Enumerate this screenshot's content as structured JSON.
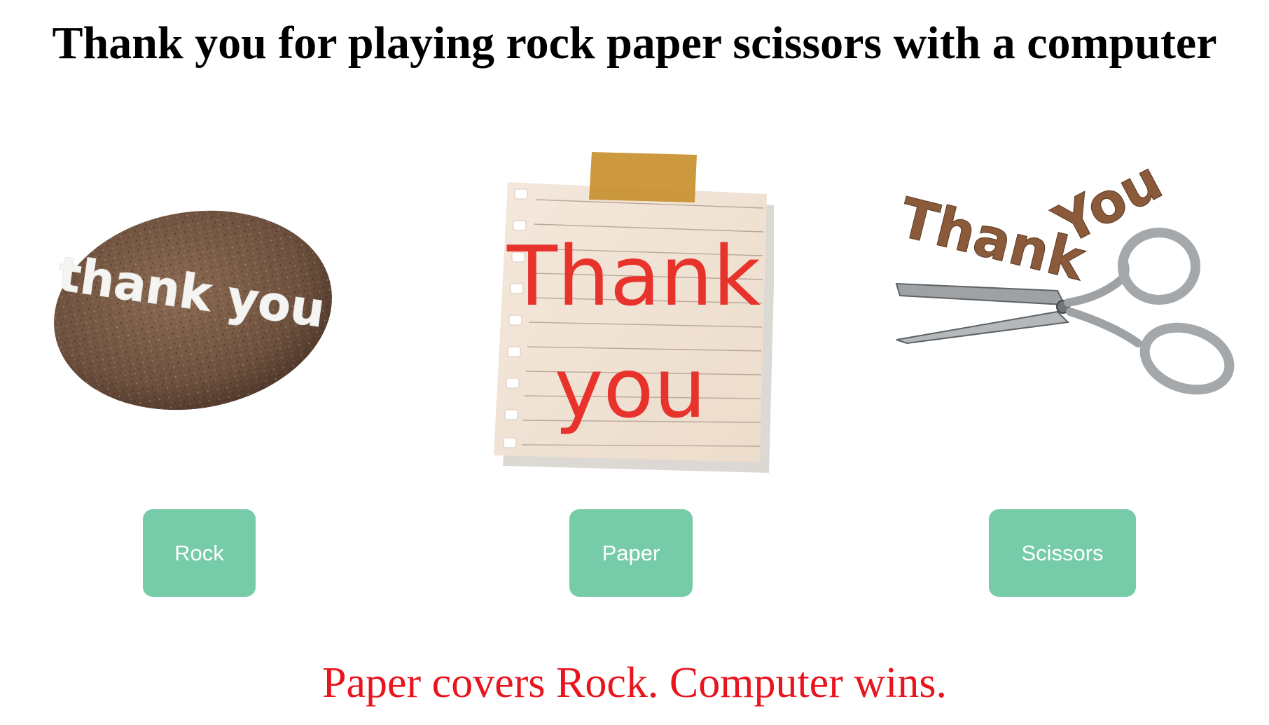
{
  "header": {
    "title": "Thank you for playing rock paper scissors with a computer"
  },
  "choices": [
    {
      "id": "rock",
      "button_label": "Rock",
      "image_text": "thank you",
      "icon": "rock-icon"
    },
    {
      "id": "paper",
      "button_label": "Paper",
      "image_text_line1": "Thank",
      "image_text_line2": "you",
      "icon": "paper-note-icon"
    },
    {
      "id": "scissors",
      "button_label": "Scissors",
      "image_text_word1": "Thank",
      "image_text_word2": "You",
      "icon": "scissors-icon"
    }
  ],
  "result": {
    "message": "Paper covers Rock. Computer wins."
  },
  "colors": {
    "button_bg": "#76cca8",
    "button_text": "#ffffff",
    "result_text": "#e8141e",
    "title_text": "#000000"
  }
}
